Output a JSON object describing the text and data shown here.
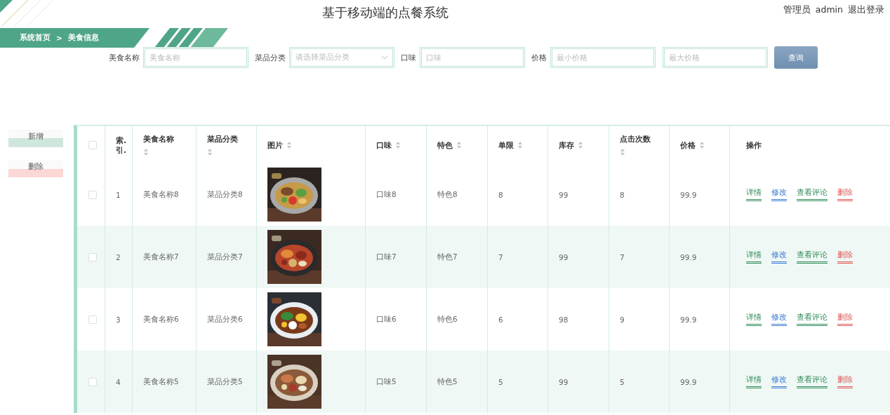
{
  "window": {
    "title": "基于移动端的点餐系统"
  },
  "user": {
    "role": "管理员",
    "name": "admin",
    "logout": "退出登录"
  },
  "breadcrumb": {
    "home": "系统首页",
    "separator": ">",
    "current": "美食信息"
  },
  "search": {
    "filters": [
      {
        "label": "美食名称",
        "fields": [
          {
            "kind": "input",
            "placeholder": "美食名称"
          }
        ]
      },
      {
        "label": "菜品分类",
        "fields": [
          {
            "kind": "select",
            "placeholder": "请选择菜品分类"
          }
        ]
      },
      {
        "label": "口味",
        "fields": [
          {
            "kind": "input",
            "placeholder": "口味"
          }
        ]
      },
      {
        "label": "价格",
        "fields": [
          {
            "kind": "input",
            "placeholder": "最小价格"
          },
          {
            "kind": "input",
            "placeholder": "最大价格"
          }
        ]
      }
    ],
    "button": "查询"
  },
  "actions": [
    {
      "kind": "add",
      "label": "新增"
    },
    {
      "kind": "delete",
      "label": "删除"
    }
  ],
  "table": {
    "all_checked": false,
    "columns": [
      {
        "label": "索.引.",
        "sortable": false
      },
      {
        "label": "美食名称",
        "sortable": true
      },
      {
        "label": "菜品分类",
        "sortable": true
      },
      {
        "label": "图片",
        "sortable": true
      },
      {
        "label": "口味",
        "sortable": true
      },
      {
        "label": "特色",
        "sortable": true
      },
      {
        "label": "单限",
        "sortable": true
      },
      {
        "label": "库存",
        "sortable": true
      },
      {
        "label": "点击次数",
        "sortable": true
      },
      {
        "label": "价格",
        "sortable": true
      },
      {
        "label": "操作",
        "sortable": false
      }
    ],
    "rows": [
      {
        "checked": false,
        "cells": [
          {
            "kind": "text",
            "text": "1"
          },
          {
            "kind": "text",
            "text": "美食名称8"
          },
          {
            "kind": "text",
            "text": "菜品分类8"
          },
          {
            "kind": "picture"
          },
          {
            "kind": "text",
            "text": "口味8"
          },
          {
            "kind": "text",
            "text": "特色8"
          },
          {
            "kind": "text",
            "text": "8"
          },
          {
            "kind": "text",
            "text": "99"
          },
          {
            "kind": "text",
            "text": "8"
          },
          {
            "kind": "text",
            "text": "99.9"
          },
          {
            "kind": "actions",
            "links": [
              {
                "label": "详情",
                "color": "#2e8b57"
              },
              {
                "label": "修改",
                "color": "#3a7bd5"
              },
              {
                "label": "查看评论",
                "color": "#2e8b57"
              },
              {
                "label": "删除",
                "color": "#e05555"
              }
            ]
          }
        ]
      },
      {
        "checked": false,
        "cells": [
          {
            "kind": "text",
            "text": "2"
          },
          {
            "kind": "text",
            "text": "美食名称7"
          },
          {
            "kind": "text",
            "text": "菜品分类7"
          },
          {
            "kind": "picture"
          },
          {
            "kind": "text",
            "text": "口味7"
          },
          {
            "kind": "text",
            "text": "特色7"
          },
          {
            "kind": "text",
            "text": "7"
          },
          {
            "kind": "text",
            "text": "99"
          },
          {
            "kind": "text",
            "text": "7"
          },
          {
            "kind": "text",
            "text": "99.9"
          },
          {
            "kind": "actions",
            "links": [
              {
                "label": "详情",
                "color": "#2e8b57"
              },
              {
                "label": "修改",
                "color": "#3a7bd5"
              },
              {
                "label": "查看评论",
                "color": "#2e8b57"
              },
              {
                "label": "删除",
                "color": "#e05555"
              }
            ]
          }
        ]
      },
      {
        "checked": false,
        "cells": [
          {
            "kind": "text",
            "text": "3"
          },
          {
            "kind": "text",
            "text": "美食名称6"
          },
          {
            "kind": "text",
            "text": "菜品分类6"
          },
          {
            "kind": "picture"
          },
          {
            "kind": "text",
            "text": "口味6"
          },
          {
            "kind": "text",
            "text": "特色6"
          },
          {
            "kind": "text",
            "text": "6"
          },
          {
            "kind": "text",
            "text": "98"
          },
          {
            "kind": "text",
            "text": "9"
          },
          {
            "kind": "text",
            "text": "99.9"
          },
          {
            "kind": "actions",
            "links": [
              {
                "label": "详情",
                "color": "#2e8b57"
              },
              {
                "label": "修改",
                "color": "#3a7bd5"
              },
              {
                "label": "查看评论",
                "color": "#2e8b57"
              },
              {
                "label": "删除",
                "color": "#e05555"
              }
            ]
          }
        ]
      },
      {
        "checked": false,
        "cells": [
          {
            "kind": "text",
            "text": "4"
          },
          {
            "kind": "text",
            "text": "美食名称5"
          },
          {
            "kind": "text",
            "text": "菜品分类5"
          },
          {
            "kind": "picture"
          },
          {
            "kind": "text",
            "text": "口味5"
          },
          {
            "kind": "text",
            "text": "特色5"
          },
          {
            "kind": "text",
            "text": "5"
          },
          {
            "kind": "text",
            "text": "99"
          },
          {
            "kind": "text",
            "text": "5"
          },
          {
            "kind": "text",
            "text": "99.9"
          },
          {
            "kind": "actions",
            "links": [
              {
                "label": "详情",
                "color": "#2e8b57"
              },
              {
                "label": "修改",
                "color": "#3a7bd5"
              },
              {
                "label": "查看评论",
                "color": "#2e8b57"
              },
              {
                "label": "删除",
                "color": "#e05555"
              }
            ]
          }
        ]
      }
    ]
  }
}
